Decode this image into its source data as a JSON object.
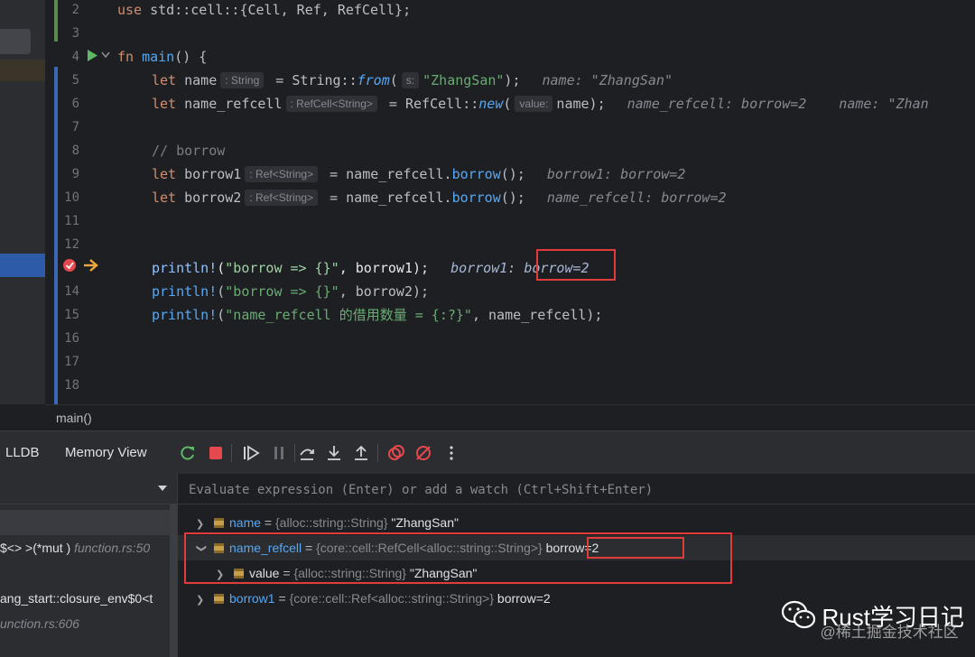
{
  "editor": {
    "line_numbers": [
      "2",
      "3",
      "4",
      "5",
      "6",
      "7",
      "8",
      "9",
      "10",
      "11",
      "12",
      "13",
      "14",
      "15",
      "16",
      "17",
      "18"
    ],
    "lines": {
      "l2": {
        "kw_use": "use",
        "path": " std::cell::{Cell, Ref, RefCell};"
      },
      "l4": {
        "kw_fn": "fn",
        "name": " main",
        "rest": "() {"
      },
      "l5": {
        "kw_let": "let",
        "var": " name",
        "hint": ": String",
        "eq": " = String::",
        "call": "from",
        "open": "(",
        "param_hint": "s:",
        "str": "\"ZhangSan\"",
        "close": ");",
        "inline": "name: \"ZhangSan\""
      },
      "l6": {
        "kw_let": "let",
        "var": " name_refcell",
        "hint": ": RefCell<String>",
        "eq": " = RefCell::",
        "call": "new",
        "open": "(",
        "param_hint": "value:",
        "arg": "name",
        "close": ");",
        "inline1": "name_refcell: borrow=2",
        "inline2": "name: \"Zhan"
      },
      "l8": {
        "comment": "// borrow"
      },
      "l9": {
        "kw_let": "let",
        "var": " borrow1",
        "hint": ": Ref<String>",
        "eq": " = name_refcell.",
        "method": "borrow",
        "close": "();",
        "inline": "borrow1: borrow=2"
      },
      "l10": {
        "kw_let": "let",
        "var": " borrow2",
        "hint": ": Ref<String>",
        "eq": " = name_refcell.",
        "method": "borrow",
        "close": "();",
        "inline": "name_refcell: borrow=2"
      },
      "l13": {
        "macro": "println!",
        "open": "(",
        "str": "\"borrow => {}\"",
        "rest": ", borrow1);",
        "inline_a": "borrow1:",
        "inline_b": "borrow=2"
      },
      "l14": {
        "macro": "println!",
        "open": "(",
        "str": "\"borrow => {}\"",
        "rest": ", borrow2);"
      },
      "l15": {
        "macro": "println!",
        "open": "(",
        "str": "\"name_refcell 的借用数量 = {:?}\"",
        "rest": ", name_refcell);"
      }
    }
  },
  "breadcrumb": {
    "label": "main()"
  },
  "toolbar": {
    "lldb": "LLDB",
    "memory_view": "Memory View"
  },
  "frames": [
    {
      "text": "$<> >(*mut )",
      "file": "function.rs:50"
    },
    {
      "text": "ang_start::closure_env$0<t",
      "file": ""
    },
    {
      "text": "",
      "file": "unction.rs:606"
    }
  ],
  "evaluate": {
    "placeholder": "Evaluate expression (Enter) or add a watch (Ctrl+Shift+Enter)"
  },
  "variables": [
    {
      "name": "name",
      "eq": " = ",
      "type": "{alloc::string::String}",
      "value": " \"ZhangSan\""
    },
    {
      "name": "name_refcell",
      "eq": " = ",
      "type": "{core::cell::RefCell<alloc::string::String>}",
      "value": " borrow=2"
    },
    {
      "name": "value",
      "eq": " = ",
      "type": "{alloc::string::String}",
      "value": " \"ZhangSan\""
    },
    {
      "name": "borrow1",
      "eq": " = ",
      "type": "{core::cell::Ref<alloc::string::String>}",
      "value": " borrow=2"
    }
  ],
  "watermark": {
    "title": "Rust学习日记",
    "sub": "@稀土掘金技术社区"
  },
  "colors": {
    "accent": "#2e5ba8",
    "highlight_box": "#e03c3c",
    "keyword": "#cf8e6d",
    "string": "#6aab73",
    "function": "#56a8f5"
  },
  "icons": [
    "run-gutter-icon",
    "fold-chevron-icon",
    "breakpoint-icon",
    "execution-arrow-icon",
    "rerun-icon",
    "stop-icon",
    "resume-icon",
    "pause-icon",
    "step-over-icon",
    "step-into-icon",
    "step-out-icon",
    "view-breakpoints-icon",
    "mute-breakpoints-icon",
    "more-icon",
    "dropdown-icon",
    "wechat-icon"
  ]
}
